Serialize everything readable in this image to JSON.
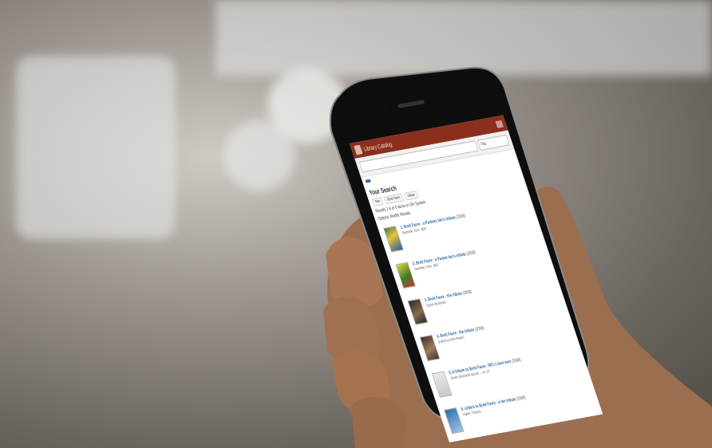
{
  "header": {
    "app_title": "Library Catalog"
  },
  "search": {
    "query": "",
    "scope": "Title"
  },
  "chip": {
    "label": ""
  },
  "results": {
    "heading": "Your Search",
    "tags": [
      "Title",
      "Brett Favre",
      "tribute"
    ],
    "count_text": "Results 1-6 of 6 items in UW System",
    "options_text": "Options: Modify Results"
  },
  "items": [
    {
      "title": "1. Brett Favre : a Packers fan's tribute",
      "year": "(2008)",
      "sub": "Nashville, Tenn. 2007"
    },
    {
      "title": "2. Brett Favre : a Packer fan's tribute",
      "year": "(2008)",
      "sub": "Nashville, Tenn. 2007"
    },
    {
      "title": "3. Brett Favre : the tribute",
      "year": "(2008)",
      "sub": "Sports Illustrated"
    },
    {
      "title": "4. Brett Favre : the tribute",
      "year": "(2008)",
      "sub": "[edited by Rob Fleder]"
    },
    {
      "title": "5. A tribute to Brett Favre : NFL's best ever",
      "year": "(2008)",
      "sub": "Sports Illustrated special ... no. 10"
    },
    {
      "title": "6. Letters to Brett Favre : a fan tribute",
      "year": "(2008)",
      "sub": "Higher, Thomas"
    }
  ]
}
